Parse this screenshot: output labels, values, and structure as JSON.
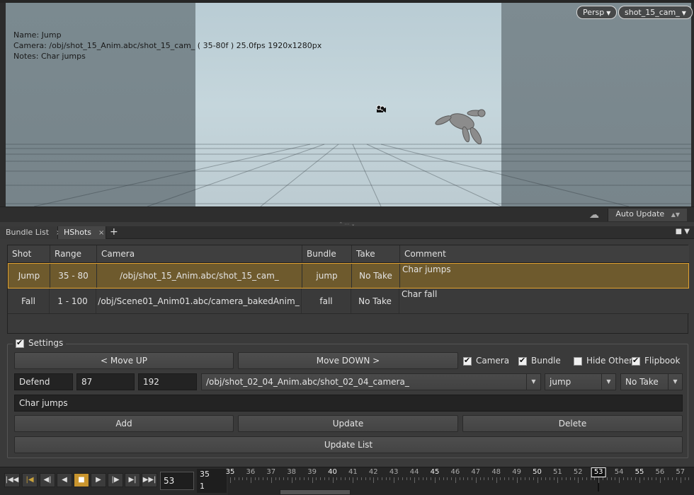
{
  "viewport": {
    "info": {
      "name_line": "Name: Jump",
      "camera_line": "Camera: /obj/shot_15_Anim.abc/shot_15_cam_ ( 35-80f ) 25.0fps 1920x1280px",
      "notes_line": "Notes: Char jumps"
    },
    "view_dropdown": "Persp",
    "camera_dropdown": "shot_15_cam_"
  },
  "status": {
    "auto_update": "Auto Update"
  },
  "tabs": [
    {
      "label": "Bundle List"
    },
    {
      "label": "HShots"
    }
  ],
  "table": {
    "headers": [
      "Shot",
      "Range",
      "Camera",
      "Bundle",
      "Take",
      "Comment"
    ],
    "rows": [
      {
        "shot": "Jump",
        "range": "35 - 80",
        "camera": "/obj/shot_15_Anim.abc/shot_15_cam_",
        "bundle": "jump",
        "take": "No Take",
        "comment": "Char jumps"
      },
      {
        "shot": "Fall",
        "range": "1 - 100",
        "camera": "/obj/Scene01_Anim01.abc/camera_bakedAnim_",
        "bundle": "fall",
        "take": "No Take",
        "comment": "Char fall"
      }
    ]
  },
  "settings": {
    "label": "Settings",
    "move_up": "<   Move UP",
    "move_down": "Move DOWN   >",
    "checkboxes": {
      "camera": "Camera",
      "bundle": "Bundle",
      "hide_other": "Hide Other",
      "flipbook": "Flipbook"
    },
    "fields": {
      "shot_name": "Defend",
      "start": "87",
      "end": "192",
      "camera_path": "/obj/shot_02_04_Anim.abc/shot_02_04_camera_",
      "bundle": "jump",
      "take": "No Take",
      "comment": "Char jumps"
    },
    "buttons": {
      "add": "Add",
      "update": "Update",
      "delete": "Delete",
      "update_list": "Update List"
    }
  },
  "playbar": {
    "current_frame": "53",
    "range_start": "35",
    "range_step": "1",
    "timeline_frames": [
      "35",
      "36",
      "37",
      "38",
      "39",
      "40",
      "41",
      "42",
      "43",
      "44",
      "45",
      "46",
      "47",
      "48",
      "49",
      "50",
      "51",
      "52",
      "53",
      "54",
      "55",
      "56",
      "57"
    ],
    "marker_frame": "53"
  }
}
